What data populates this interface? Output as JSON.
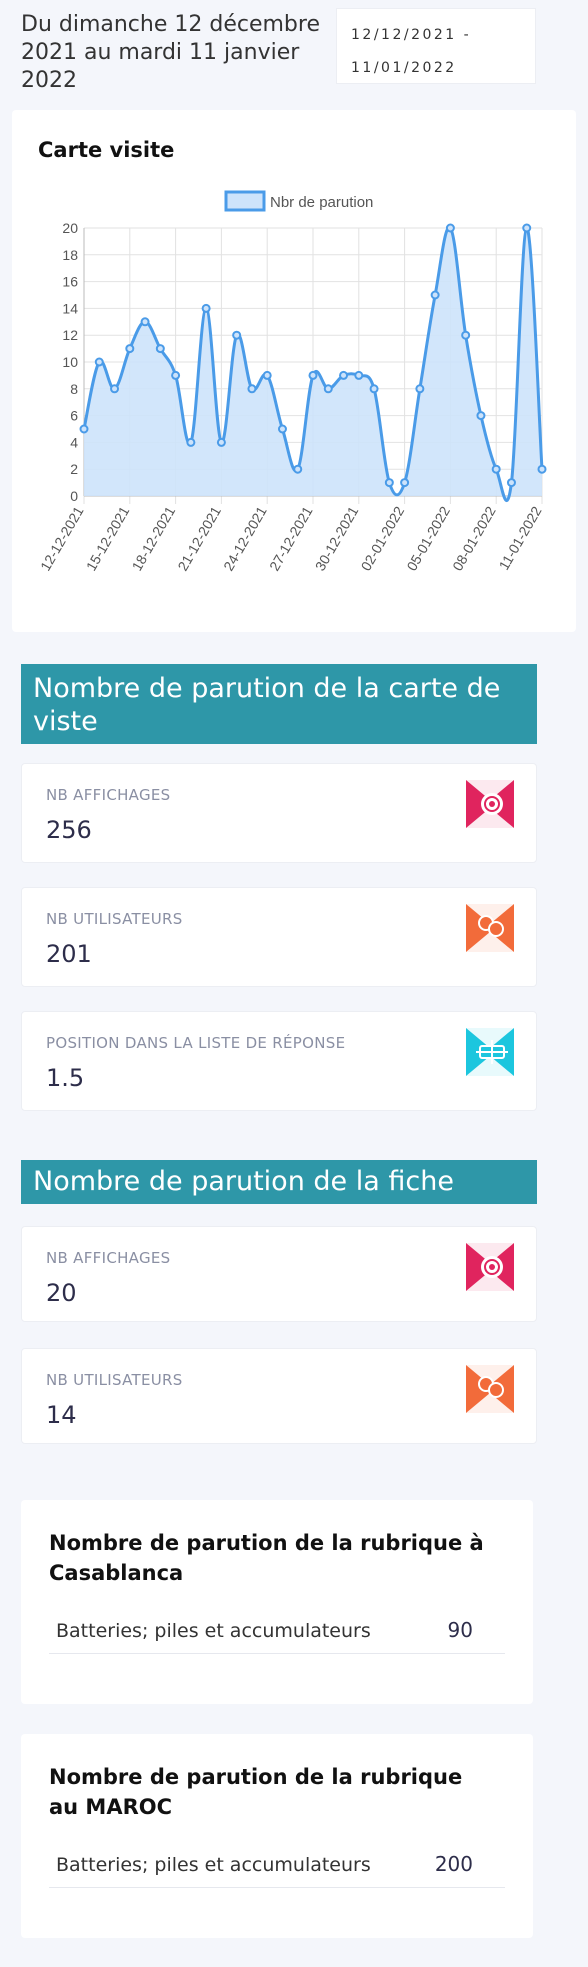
{
  "header": {
    "period_text": "Du dimanche 12 décembre 2021 au mardi 11 janvier 2022",
    "date_range_line1": "12/12/2021 -",
    "date_range_line2": "11/01/2022"
  },
  "chart_card": {
    "title": "Carte visite"
  },
  "chart_data": {
    "type": "area",
    "legend": "Nbr de parution",
    "ylim": [
      0,
      20
    ],
    "yticks": [
      0,
      2,
      4,
      6,
      8,
      10,
      12,
      14,
      16,
      18,
      20
    ],
    "x": [
      "12-12-2021",
      "13-12-2021",
      "14-12-2021",
      "15-12-2021",
      "16-12-2021",
      "17-12-2021",
      "18-12-2021",
      "19-12-2021",
      "20-12-2021",
      "21-12-2021",
      "22-12-2021",
      "23-12-2021",
      "24-12-2021",
      "25-12-2021",
      "26-12-2021",
      "27-12-2021",
      "28-12-2021",
      "29-12-2021",
      "30-12-2021",
      "31-12-2021",
      "01-01-2022",
      "02-01-2022",
      "03-01-2022",
      "04-01-2022",
      "05-01-2022",
      "06-01-2022",
      "07-01-2022",
      "08-01-2022",
      "09-01-2022",
      "10-01-2022",
      "11-01-2022"
    ],
    "tick_labels": [
      "12-12-2021",
      "15-12-2021",
      "18-12-2021",
      "21-12-2021",
      "24-12-2021",
      "27-12-2021",
      "30-12-2021",
      "02-01-2022",
      "05-01-2022",
      "08-01-2022",
      "11-01-2022"
    ],
    "series": [
      {
        "name": "Nbr de parution",
        "values": [
          5,
          10,
          8,
          11,
          13,
          11,
          9,
          4,
          14,
          4,
          12,
          8,
          9,
          5,
          2,
          9,
          8,
          9,
          9,
          8,
          1,
          1,
          8,
          15,
          20,
          12,
          6,
          2,
          1,
          20,
          2
        ]
      }
    ],
    "grid": true,
    "colors": {
      "line": "#4a9be8",
      "fill": "#cde3fb"
    }
  },
  "section_carte": {
    "title": "Nombre de parution de la carte de viste",
    "stats": [
      {
        "label": "NB AFFICHAGES",
        "value": "256",
        "icon": "eye-icon",
        "color": "#e0245e"
      },
      {
        "label": "NB UTILISATEURS",
        "value": "201",
        "icon": "users-icon",
        "color": "#f26b3a"
      },
      {
        "label": "POSITION DANS LA LISTE DE RÉPONSE",
        "value": "1.5",
        "icon": "list-position-icon",
        "color": "#1cc6de"
      }
    ]
  },
  "section_fiche": {
    "title": "Nombre de parution de la fiche",
    "stats": [
      {
        "label": "NB AFFICHAGES",
        "value": "20",
        "icon": "eye-icon",
        "color": "#e0245e"
      },
      {
        "label": "NB UTILISATEURS",
        "value": "14",
        "icon": "users-icon",
        "color": "#f26b3a"
      }
    ]
  },
  "rubrique_casablanca": {
    "title": "Nombre de parution de la rubrique à Casablanca",
    "rows": [
      {
        "name": "Batteries; piles et accumulateurs",
        "value": "90"
      }
    ]
  },
  "rubrique_maroc": {
    "title": "Nombre de parution de la rubrique au MAROC",
    "rows": [
      {
        "name": "Batteries; piles et accumulateurs",
        "value": "200"
      }
    ]
  }
}
